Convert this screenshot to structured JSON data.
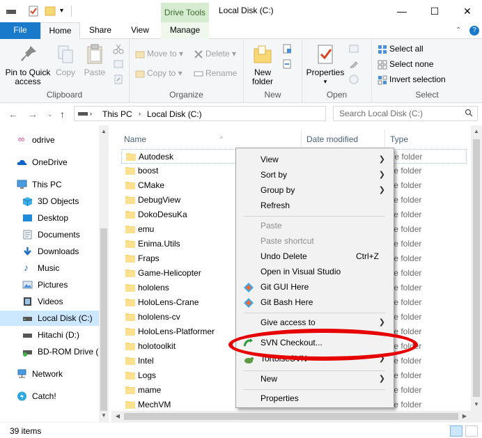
{
  "titlebar": {
    "title": "Local Disk (C:)",
    "context_tab_header": "Drive Tools",
    "minimize": "—",
    "maximize": "☐",
    "close": "✕"
  },
  "tabs": {
    "file": "File",
    "home": "Home",
    "share": "Share",
    "view": "View",
    "manage": "Manage",
    "collapse": "⌃",
    "help": "?"
  },
  "ribbon": {
    "clipboard": {
      "label": "Clipboard",
      "pin": "Pin to Quick access",
      "copy": "Copy",
      "paste": "Paste"
    },
    "organize": {
      "label": "Organize",
      "move_to": "Move to",
      "copy_to": "Copy to",
      "delete": "Delete",
      "rename": "Rename"
    },
    "new": {
      "label": "New",
      "new_folder": "New folder"
    },
    "open": {
      "label": "Open",
      "properties": "Properties"
    },
    "select": {
      "label": "Select",
      "select_all": "Select all",
      "select_none": "Select none",
      "invert_selection": "Invert selection"
    }
  },
  "address": {
    "crumbs": [
      "This PC",
      "Local Disk (C:)"
    ],
    "search_placeholder": "Search Local Disk (C:)"
  },
  "nav": {
    "items": [
      {
        "label": "odrive",
        "icon": "odrive-icon"
      },
      {
        "label": "OneDrive",
        "icon": "cloud-icon"
      },
      {
        "label": "This PC",
        "icon": "computer-icon"
      },
      {
        "label": "3D Objects",
        "icon": "cube-icon"
      },
      {
        "label": "Desktop",
        "icon": "desktop-icon"
      },
      {
        "label": "Documents",
        "icon": "document-icon"
      },
      {
        "label": "Downloads",
        "icon": "download-icon"
      },
      {
        "label": "Music",
        "icon": "music-icon"
      },
      {
        "label": "Pictures",
        "icon": "picture-icon"
      },
      {
        "label": "Videos",
        "icon": "video-icon"
      },
      {
        "label": "Local Disk (C:)",
        "icon": "drive-icon"
      },
      {
        "label": "Hitachi (D:)",
        "icon": "drive-icon"
      },
      {
        "label": "BD-ROM Drive (I",
        "icon": "disc-icon"
      },
      {
        "label": "Network",
        "icon": "network-icon"
      },
      {
        "label": "Catch!",
        "icon": "catch-icon"
      }
    ]
  },
  "files": {
    "columns": {
      "name": "Name",
      "date": "Date modified",
      "type": "Type"
    },
    "type_text": "ile folder",
    "rows": [
      "Autodesk",
      "boost",
      "CMake",
      "DebugView",
      "DokoDesuKa",
      "emu",
      "Enima.Utils",
      "Fraps",
      "Game-Helicopter",
      "hololens",
      "HoloLens-Crane",
      "hololens-cv",
      "HoloLens-Platformer",
      "holotoolkit",
      "Intel",
      "Logs",
      "mame",
      "MechVM"
    ]
  },
  "context_menu": {
    "view": "View",
    "sort_by": "Sort by",
    "group_by": "Group by",
    "refresh": "Refresh",
    "paste": "Paste",
    "paste_shortcut": "Paste shortcut",
    "undo_delete": "Undo Delete",
    "undo_shortcut": "Ctrl+Z",
    "open_vs": "Open in Visual Studio",
    "git_gui": "Git GUI Here",
    "git_bash": "Git Bash Here",
    "give_access": "Give access to",
    "svn_checkout": "SVN Checkout...",
    "tortoise": "TortoiseSVN",
    "new": "New",
    "properties": "Properties"
  },
  "status": {
    "items_count": "39 items"
  },
  "colors": {
    "file_tab": "#1979ca",
    "selection": "#cce8ff",
    "highlight_ellipse": "#e60000",
    "drive_tools": "#d6ecd0"
  }
}
